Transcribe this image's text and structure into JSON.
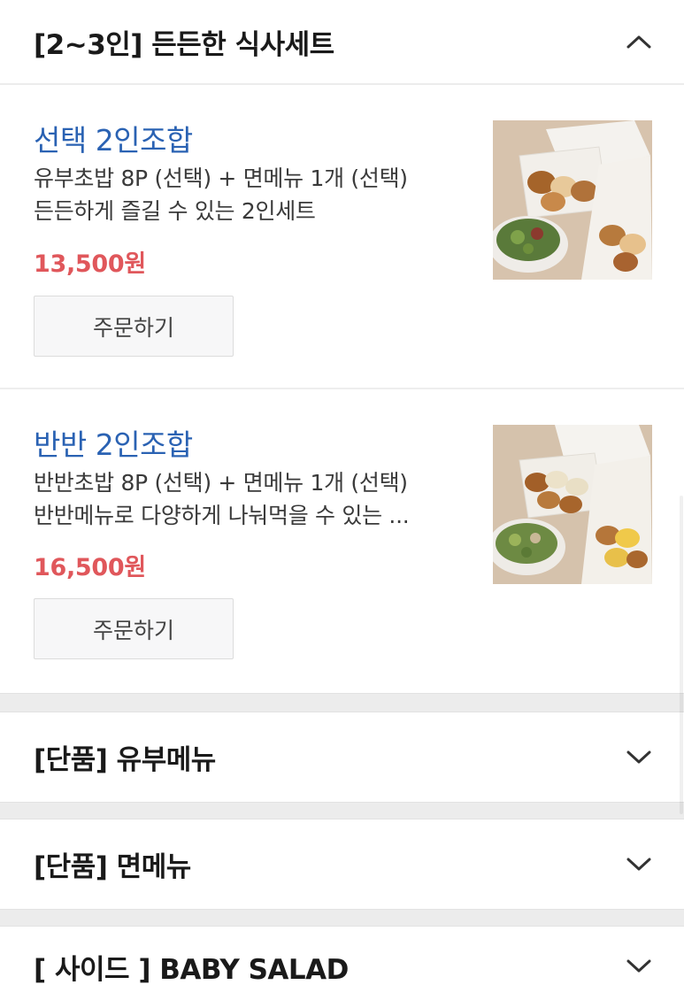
{
  "sections": {
    "top": {
      "title": "[2~3인] 든든한 식사세트",
      "expanded": true
    },
    "tofu": {
      "title": "[단품] 유부메뉴",
      "expanded": false
    },
    "noodle": {
      "title": "[단품] 면메뉴",
      "expanded": false
    },
    "side": {
      "title": "[ 사이드 ] BABY SALAD",
      "expanded": false
    }
  },
  "items": [
    {
      "name": "선택 2인조합",
      "desc_line1": "유부초밥 8P (선택) + 면메뉴 1개 (선택)",
      "desc_line2": "든든하게 즐길 수 있는 2인세트",
      "price": "13,500원",
      "order_label": "주문하기",
      "image": "food-photo"
    },
    {
      "name": "반반 2인조합",
      "desc_line1": "반반초밥 8P (선택) + 면메뉴 1개 (선택)",
      "desc_line2": "반반메뉴로 다양하게 나눠먹을 수 있는 ...",
      "price": "16,500원",
      "order_label": "주문하기",
      "image": "food-photo"
    }
  ],
  "colors": {
    "item_name": "#2a62b3",
    "price": "#e0575b",
    "separator": "#ececec"
  },
  "icons": {
    "expanded": "chevron-up-icon",
    "collapsed": "chevron-down-icon"
  }
}
